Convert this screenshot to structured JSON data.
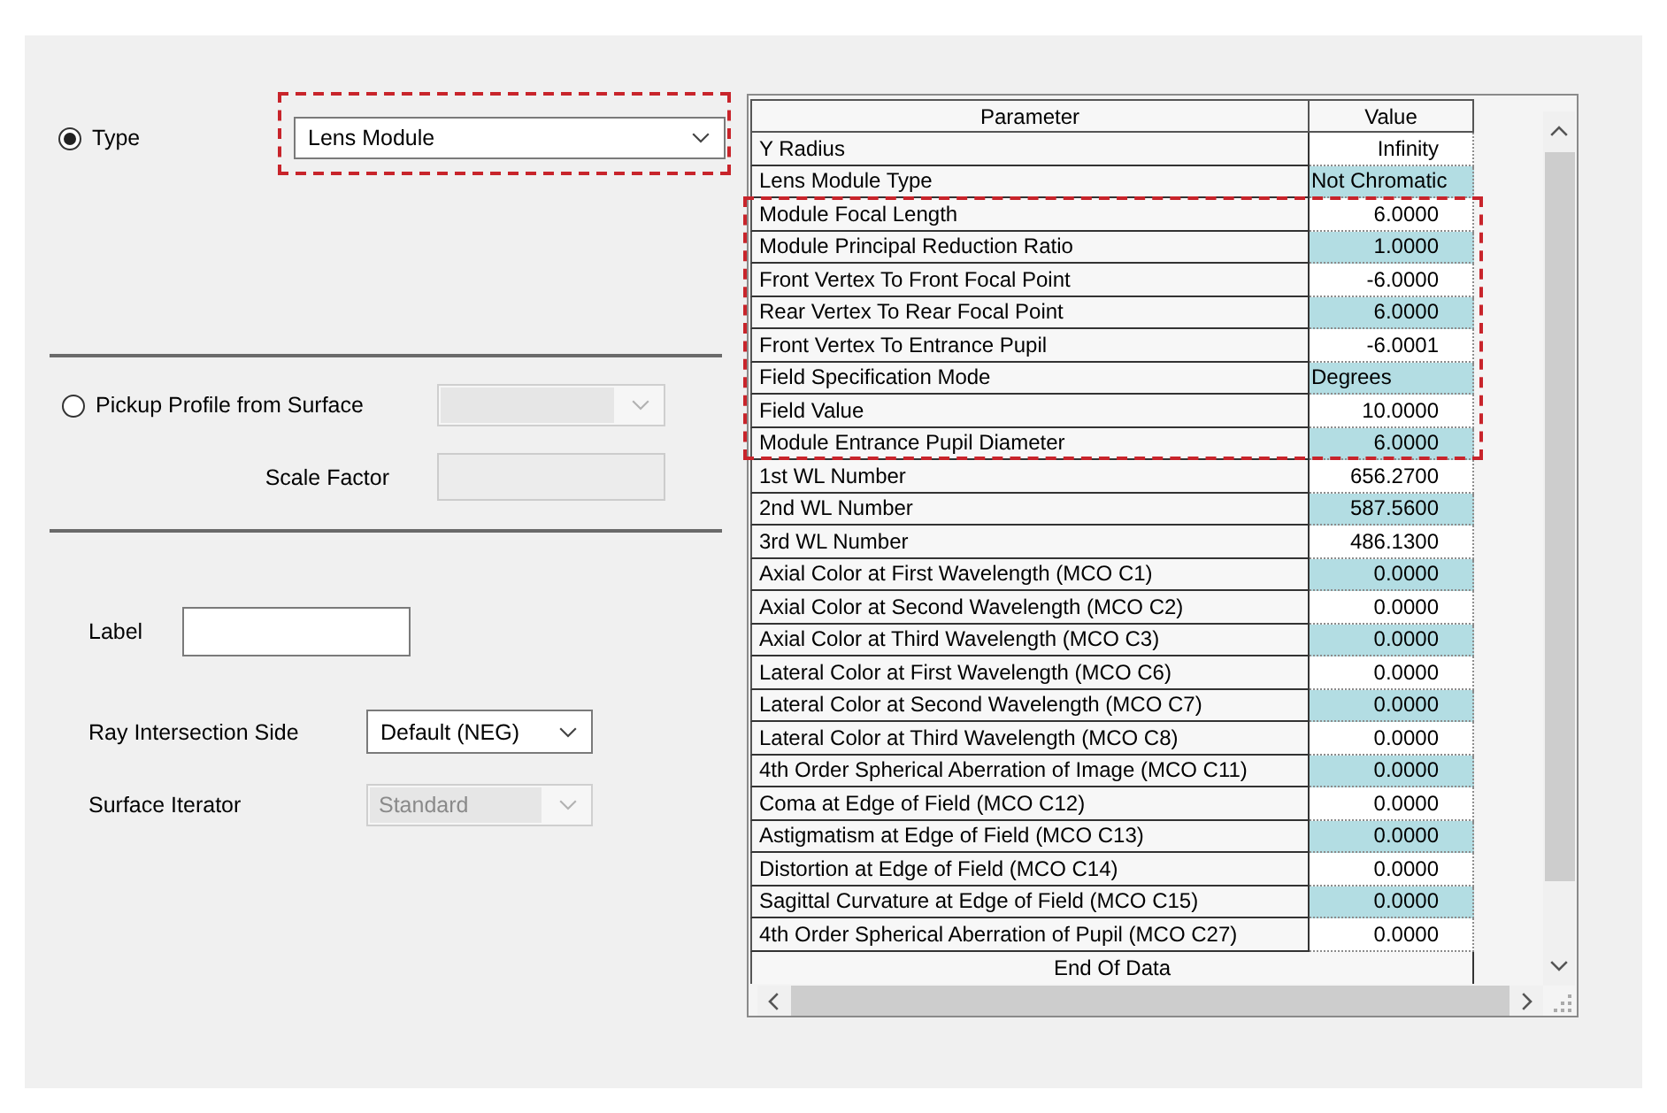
{
  "type_section": {
    "radio": {
      "label": "Type",
      "selected": true
    },
    "dropdown": {
      "value": "Lens Module",
      "framed": true
    }
  },
  "pickup_section": {
    "radio": {
      "label": "Pickup Profile from Surface",
      "selected": false
    },
    "surface_dropdown": {
      "disabled": true
    },
    "scale_factor": {
      "label": "Scale Factor",
      "disabled": true
    }
  },
  "label_field": {
    "label": "Label"
  },
  "ray_intersection_side": {
    "label": "Ray Intersection Side",
    "value": "Default (NEG)",
    "disabled": false
  },
  "surface_iterator": {
    "label": "Surface Iterator",
    "value": "Standard",
    "disabled": true
  },
  "grid": {
    "columns": [
      "Parameter",
      "Value"
    ],
    "sections": [
      {
        "framed": false,
        "rows": [
          {
            "parameter": "Y Radius",
            "value": "Infinity",
            "kind": "number"
          },
          {
            "parameter": "Lens Module Type",
            "value": "Not Chromatic",
            "kind": "option"
          }
        ]
      },
      {
        "framed": true,
        "rows": [
          {
            "parameter": "Module Focal Length",
            "value": "6.0000",
            "kind": "number"
          },
          {
            "parameter": "Module Principal Reduction Ratio",
            "value": "1.0000",
            "kind": "number"
          },
          {
            "parameter": "Front Vertex To Front Focal Point",
            "value": "-6.0000",
            "kind": "number"
          },
          {
            "parameter": "Rear Vertex To Rear Focal Point",
            "value": "6.0000",
            "kind": "number"
          },
          {
            "parameter": "Front Vertex To Entrance Pupil",
            "value": "-6.0001",
            "kind": "number"
          },
          {
            "parameter": "Field Specification Mode",
            "value": "Degrees",
            "kind": "option"
          },
          {
            "parameter": "Field Value",
            "value": "10.0000",
            "kind": "number"
          },
          {
            "parameter": "Module Entrance Pupil Diameter",
            "value": "6.0000",
            "kind": "number"
          }
        ]
      },
      {
        "framed": false,
        "rows": [
          {
            "parameter": "1st WL Number",
            "value": "656.2700",
            "kind": "number"
          },
          {
            "parameter": "2nd WL Number",
            "value": "587.5600",
            "kind": "number"
          },
          {
            "parameter": "3rd WL Number",
            "value": "486.1300",
            "kind": "number"
          },
          {
            "parameter": "Axial Color at First Wavelength (MCO C1)",
            "value": "0.0000",
            "kind": "number"
          },
          {
            "parameter": "Axial Color at Second Wavelength (MCO C2)",
            "value": "0.0000",
            "kind": "number"
          },
          {
            "parameter": "Axial Color at Third Wavelength (MCO C3)",
            "value": "0.0000",
            "kind": "number"
          },
          {
            "parameter": "Lateral Color at First Wavelength (MCO C6)",
            "value": "0.0000",
            "kind": "number"
          },
          {
            "parameter": "Lateral Color at Second Wavelength (MCO C7)",
            "value": "0.0000",
            "kind": "number"
          },
          {
            "parameter": "Lateral Color at Third Wavelength (MCO C8)",
            "value": "0.0000",
            "kind": "number"
          },
          {
            "parameter": "4th Order Spherical Aberration of Image (MCO C11)",
            "value": "0.0000",
            "kind": "number"
          },
          {
            "parameter": "Coma at Edge of Field (MCO C12)",
            "value": "0.0000",
            "kind": "number"
          },
          {
            "parameter": "Astigmatism at Edge of Field (MCO C13)",
            "value": "0.0000",
            "kind": "number"
          },
          {
            "parameter": "Distortion at Edge of Field (MCO C14)",
            "value": "0.0000",
            "kind": "number"
          },
          {
            "parameter": "Sagittal Curvature at Edge of Field (MCO C15)",
            "value": "0.0000",
            "kind": "number"
          },
          {
            "parameter": "4th Order Spherical Aberration of Pupil (MCO C27)",
            "value": "0.0000",
            "kind": "number"
          }
        ]
      }
    ],
    "footer": "End Of Data"
  }
}
